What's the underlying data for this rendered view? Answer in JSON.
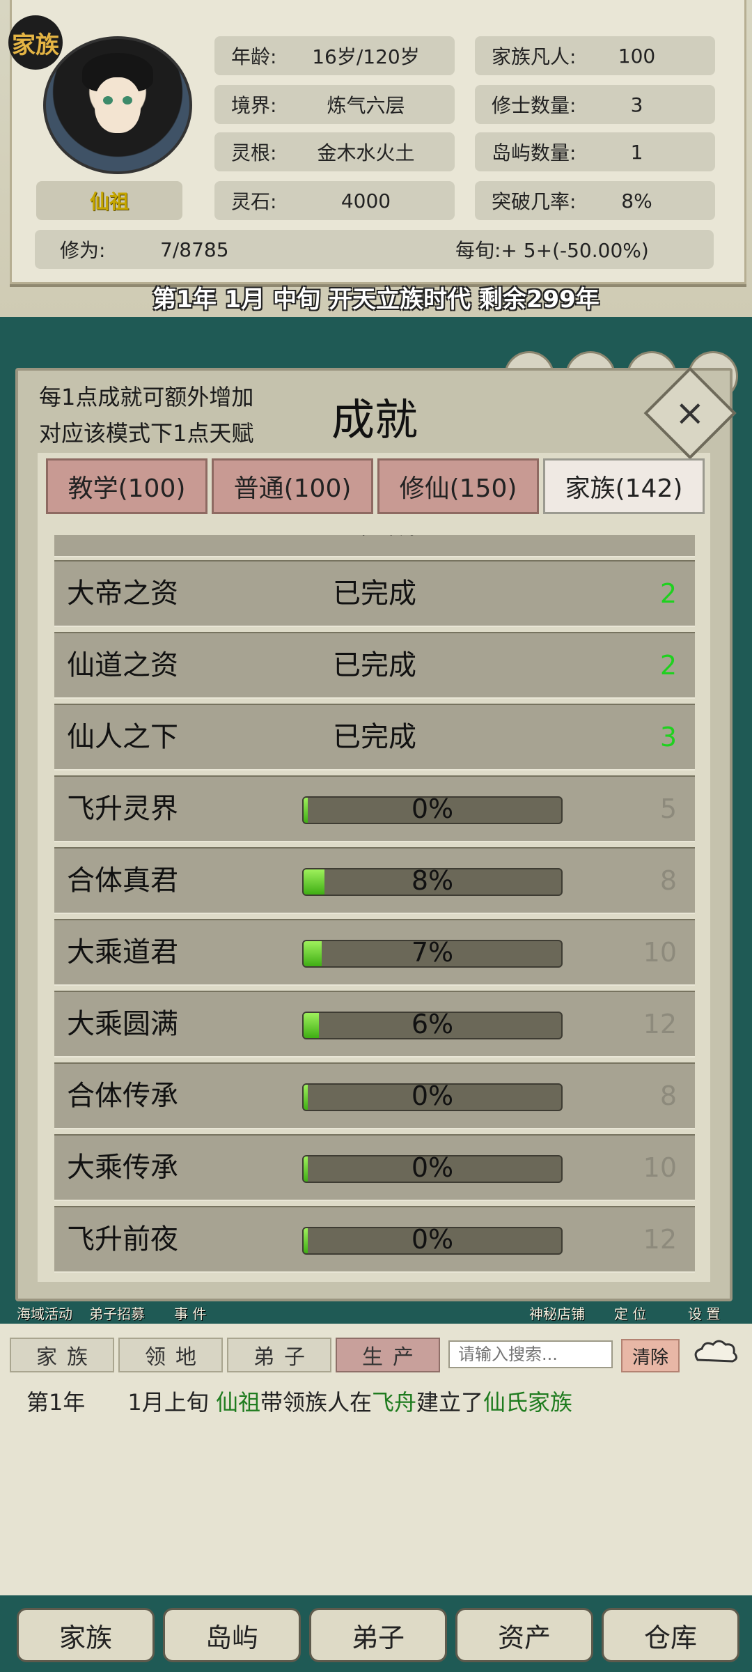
{
  "header": {
    "badge": "家族",
    "name": "仙祖",
    "stats_left": [
      {
        "label": "年龄:",
        "value": "16岁/120岁"
      },
      {
        "label": "境界:",
        "value": "炼气六层"
      },
      {
        "label": "灵根:",
        "value": "金木水火土"
      },
      {
        "label": "灵石:",
        "value": "4000"
      }
    ],
    "stats_right": [
      {
        "label": "家族凡人:",
        "value": "100"
      },
      {
        "label": "修士数量:",
        "value": "3"
      },
      {
        "label": "岛屿数量:",
        "value": "1"
      },
      {
        "label": "突破几率:",
        "value": "8%"
      }
    ],
    "cultivation_label": "修为:",
    "cultivation_value": "7/8785",
    "per_turn": "每旬:+ 5+(-50.00%)",
    "era": "第1年 1月 中旬  开天立族时代 剩余299年"
  },
  "background_labels": [
    "海域活动",
    "弟子招募",
    "事 件",
    "神秘店铺",
    "定 位",
    "设 置"
  ],
  "modal": {
    "hint_line1": "每1点成就可额外增加",
    "hint_line2": "对应该模式下1点天赋",
    "title": "成就",
    "close": "×",
    "tabs": [
      "教学(100)",
      "普通(100)",
      "修仙(150)",
      "家族(142)"
    ],
    "active_tab": 3,
    "rows": [
      {
        "name": "大帝之资",
        "done": "已完成",
        "points": "2"
      },
      {
        "name": "仙道之资",
        "done": "已完成",
        "points": "2"
      },
      {
        "name": "仙人之下",
        "done": "已完成",
        "points": "3"
      },
      {
        "name": "飞升灵界",
        "progress": 0,
        "progress_text": "0%",
        "points": "5"
      },
      {
        "name": "合体真君",
        "progress": 8,
        "progress_text": "8%",
        "points": "8"
      },
      {
        "name": "大乘道君",
        "progress": 7,
        "progress_text": "7%",
        "points": "10"
      },
      {
        "name": "大乘圆满",
        "progress": 6,
        "progress_text": "6%",
        "points": "12"
      },
      {
        "name": "合体传承",
        "progress": 0,
        "progress_text": "0%",
        "points": "8"
      },
      {
        "name": "大乘传承",
        "progress": 0,
        "progress_text": "0%",
        "points": "10"
      },
      {
        "name": "飞升前夜",
        "progress": 0,
        "progress_text": "0%",
        "points": "12"
      }
    ],
    "partial_row": {
      "done": "已完成"
    }
  },
  "log": {
    "tabs": [
      "家族",
      "领地",
      "弟子",
      "生产"
    ],
    "active_tab": 3,
    "search_placeholder": "请输入搜索...",
    "clear": "清除",
    "entry": {
      "year": "第1年",
      "period": "1月上旬",
      "actor": "仙祖",
      "t1": "带领族人在",
      "place": "飞舟",
      "t2": "建立了",
      "clan": "仙氏家族"
    }
  },
  "nav": [
    "家族",
    "岛屿",
    "弟子",
    "资产",
    "仓库"
  ]
}
